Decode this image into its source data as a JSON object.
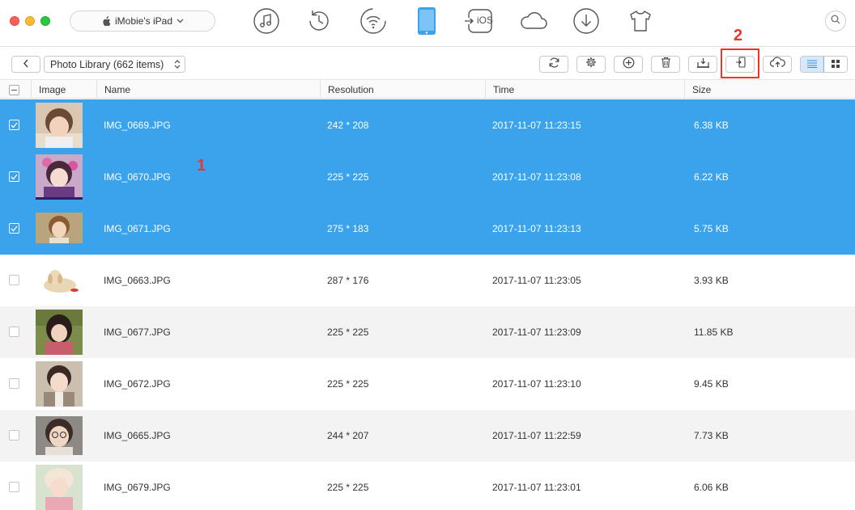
{
  "titlebar": {
    "device_name": "iMobie's iPad",
    "nav_icons": [
      "music-icon",
      "history-icon",
      "wifi-icon",
      "ipad-icon",
      "to-ios-icon",
      "cloud-icon",
      "download-icon",
      "tshirt-icon"
    ],
    "to_ios_label": "iOS"
  },
  "toolbar": {
    "library_label": "Photo Library (662 items)"
  },
  "annotations": {
    "one": "1",
    "two": "2"
  },
  "colors": {
    "selected_row": "#3aa3ec",
    "active_nav": "#3aa3ec",
    "highlight": "#e8382b"
  },
  "table": {
    "headers": {
      "image": "Image",
      "name": "Name",
      "resolution": "Resolution",
      "time": "Time",
      "size": "Size"
    },
    "rows": [
      {
        "name": "IMG_0669.JPG",
        "resolution": "242 * 208",
        "time": "2017-11-07 11:23:15",
        "size": "6.38 KB",
        "selected": true
      },
      {
        "name": "IMG_0670.JPG",
        "resolution": "225 * 225",
        "time": "2017-11-07 11:23:08",
        "size": "6.22 KB",
        "selected": true
      },
      {
        "name": "IMG_0671.JPG",
        "resolution": "275 * 183",
        "time": "2017-11-07 11:23:13",
        "size": "5.75 KB",
        "selected": true
      },
      {
        "name": "IMG_0663.JPG",
        "resolution": "287 * 176",
        "time": "2017-11-07 11:23:05",
        "size": "3.93 KB",
        "selected": false
      },
      {
        "name": "IMG_0677.JPG",
        "resolution": "225 * 225",
        "time": "2017-11-07 11:23:09",
        "size": "11.85 KB",
        "selected": false
      },
      {
        "name": "IMG_0672.JPG",
        "resolution": "225 * 225",
        "time": "2017-11-07 11:23:10",
        "size": "9.45 KB",
        "selected": false
      },
      {
        "name": "IMG_0665.JPG",
        "resolution": "244 * 207",
        "time": "2017-11-07 11:22:59",
        "size": "7.73 KB",
        "selected": false
      },
      {
        "name": "IMG_0679.JPG",
        "resolution": "225 * 225",
        "time": "2017-11-07 11:23:01",
        "size": "6.06 KB",
        "selected": false
      }
    ]
  }
}
